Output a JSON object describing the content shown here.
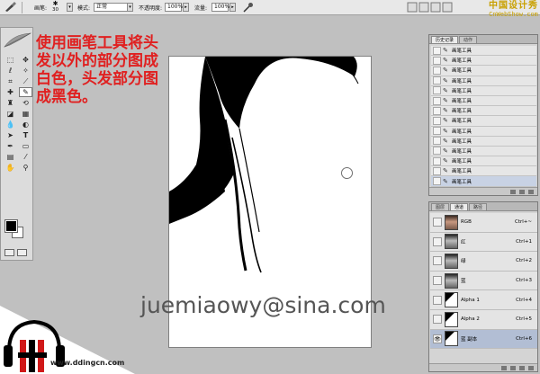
{
  "options_bar": {
    "brush_label": "画笔:",
    "brush_size": "30",
    "mode_label": "模式:",
    "mode_value": "正常",
    "opacity_label": "不透明度:",
    "opacity_value": "100%",
    "flow_label": "流量:",
    "flow_value": "100%"
  },
  "site_logo": {
    "cn": "中国设计秀",
    "en": "CnWebShow.com"
  },
  "caption": "使用画笔工具将头发以外的部分图成白色，头发部分图成黑色。",
  "watermark": "juemiaowy@sina.com",
  "history_panel": {
    "tabs": [
      "历史记录",
      "动作"
    ],
    "active_tab": 0,
    "items": [
      "画笔工具",
      "画笔工具",
      "画笔工具",
      "画笔工具",
      "画笔工具",
      "画笔工具",
      "画笔工具",
      "画笔工具",
      "画笔工具",
      "画笔工具",
      "画笔工具",
      "画笔工具",
      "画笔工具",
      "画笔工具"
    ]
  },
  "channels_panel": {
    "tabs": [
      "图层",
      "通道",
      "路径"
    ],
    "active_tab": 1,
    "channels": [
      {
        "name": "RGB",
        "shortcut": "Ctrl+~",
        "thumb": "color"
      },
      {
        "name": "红",
        "shortcut": "Ctrl+1",
        "thumb": "gray"
      },
      {
        "name": "绿",
        "shortcut": "Ctrl+2",
        "thumb": "gray"
      },
      {
        "name": "蓝",
        "shortcut": "Ctrl+3",
        "thumb": "gray"
      },
      {
        "name": "Alpha 1",
        "shortcut": "Ctrl+4",
        "thumb": "mask"
      },
      {
        "name": "Alpha 2",
        "shortcut": "Ctrl+5",
        "thumb": "mask"
      },
      {
        "name": "蓝 副本",
        "shortcut": "Ctrl+6",
        "thumb": "mask"
      }
    ],
    "active_index": 6
  },
  "brand": {
    "url": "www.ddingcn.com"
  },
  "colors": {
    "caption": "#e02020",
    "foreground": "#000000",
    "background": "#ffffff"
  }
}
